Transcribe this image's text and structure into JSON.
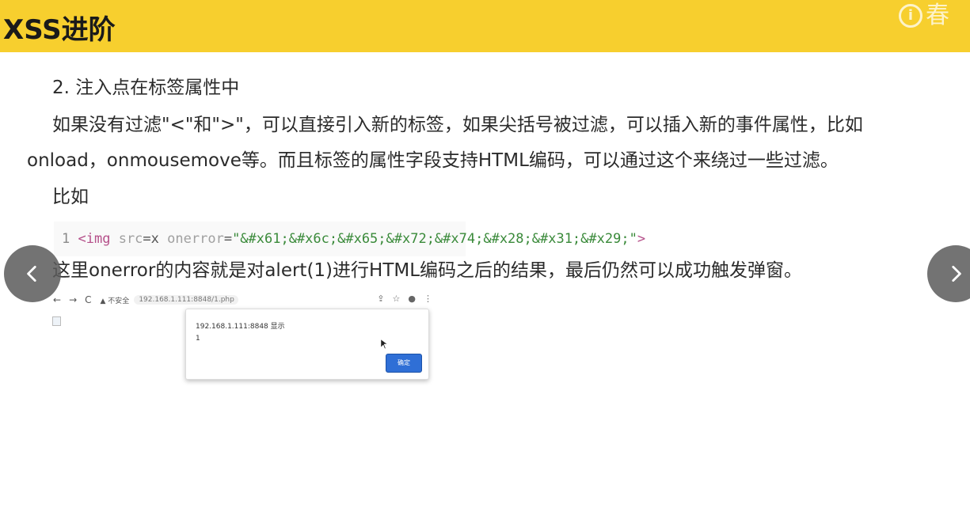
{
  "header": {
    "title": "XSS进阶",
    "watermark_text": "春"
  },
  "content": {
    "line1": "2. 注入点在标签属性中",
    "line2": "如果没有过滤\"<\"和\">\"，可以直接引入新的标签，如果尖括号被过滤，可以插入新的事件属性，比如",
    "line3": "onload，onmousemove等。而且标签的属性字段支持HTML编码，可以通过这个来绕过一些过滤。",
    "line4": "比如",
    "line5": "这里onerror的内容就是对alert(1)进行HTML编码之后的结果，最后仍然可以成功触发弹窗。"
  },
  "code": {
    "line_number": "1",
    "tag_open": "<img",
    "attr1": "src",
    "val1": "=x",
    "attr2": "onerror",
    "eq": "=",
    "value": "\"&#x61;&#x6c;&#x65;&#x72;&#x74;&#x28;&#x31;&#x29;\"",
    "tag_close": ">"
  },
  "browser": {
    "back": "←",
    "forward": "→",
    "reload": "C",
    "insecure": "▲ 不安全",
    "url": "192.168.1.111:8848/1.php",
    "dialog_title": "192.168.1.111:8848 显示",
    "dialog_message": "1",
    "ok_label": "确定"
  },
  "nav": {
    "prev_icon": "chevron-left-icon",
    "next_icon": "chevron-right-icon"
  },
  "colors": {
    "header_bg": "#f7cf2e",
    "nav_bg": "#5a5a5a",
    "ok_button": "#2f6fd6"
  }
}
